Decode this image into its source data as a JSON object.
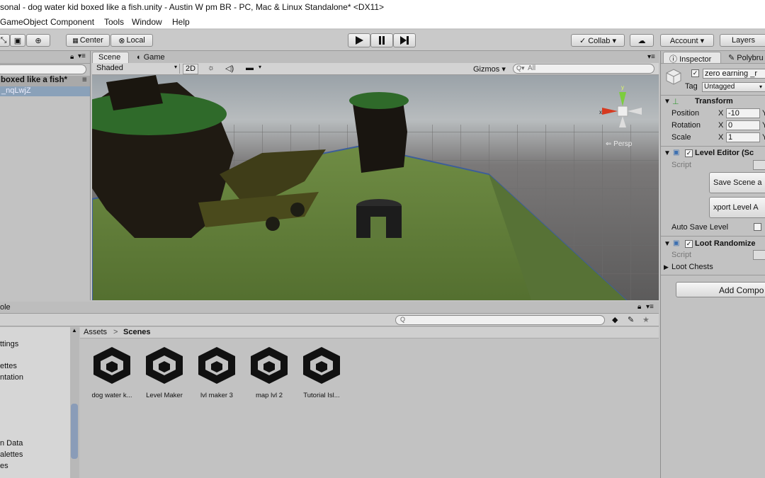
{
  "window": {
    "title": "sonal - dog water kid boxed like a fish.unity - Austin W pm BR - PC, Mac & Linux Standalone* <DX11>"
  },
  "menu": [
    "GameObject",
    "Component",
    "Tools",
    "Window",
    "Help"
  ],
  "toolbar": {
    "center_label": "Center",
    "local_label": "Local",
    "collab_label": "Collab ▾",
    "account_label": "Account ▾",
    "layers_label": "Layers"
  },
  "hierarchy": {
    "scene_name": "boxed like a fish*",
    "item": "_nqLwjZ"
  },
  "scene": {
    "tab_scene": "Scene",
    "tab_game": "Game",
    "shading": "Shaded",
    "mode_2d": "2D",
    "gizmos": "Gizmos ▾",
    "search_placeholder": "All",
    "persp": "Persp"
  },
  "project": {
    "tab": "ole",
    "breadcrumb_root": "Assets",
    "breadcrumb_sep": ">",
    "breadcrumb_current": "Scenes",
    "left_items": [
      "ttings",
      "ettes",
      "ntation",
      "n Data",
      "alettes",
      "es"
    ],
    "assets": [
      {
        "name": "dog water k..."
      },
      {
        "name": "Level Maker"
      },
      {
        "name": "lvl maker 3"
      },
      {
        "name": "map lvl 2"
      },
      {
        "name": "Tutorial Isl..."
      }
    ]
  },
  "inspector": {
    "tab_inspector": "Inspector",
    "tab_poly": "Polybru",
    "object_name": "zero earning _r",
    "tag_label": "Tag",
    "tag_value": "Untagged",
    "transform": {
      "title": "Transform",
      "position_label": "Position",
      "rotation_label": "Rotation",
      "scale_label": "Scale",
      "x_label": "X",
      "y_label": "Y",
      "position_x": "-10",
      "rotation_x": "0",
      "scale_x": "1"
    },
    "level_editor": {
      "title": "Level Editor (Sc",
      "script_label": "Script",
      "save_button": "Save Scene a",
      "export_button": "xport Level A",
      "autosave_label": "Auto Save Level"
    },
    "loot": {
      "title": "Loot Randomize",
      "script_label": "Script",
      "chests_label": "Loot Chests"
    },
    "add_component": "Add Compo"
  },
  "colors": {
    "accent": "#3c7fd6",
    "grass": "#5b7a35",
    "panel": "#c2c2c2"
  }
}
